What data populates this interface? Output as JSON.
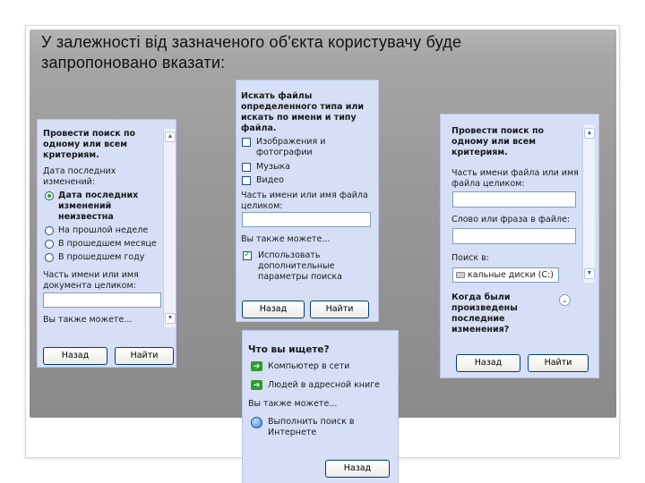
{
  "slide": {
    "title_line1": "У залежності від зазначеного об'єкта користувачу буде",
    "title_line2": "запропоновано вказати:"
  },
  "pane_left": {
    "header": "Провести поиск по одному или всем критериям.",
    "header_l1": "Провести поиск по",
    "header_l2": "одному или всем",
    "header_l3": "критериям.",
    "date_label_l1": "Дата последних",
    "date_label_l2": "изменений:",
    "options": [
      "Дата последних изменений неизвестна",
      "На прошлой неделе",
      "В прошедшем месяце",
      "В прошедшем году"
    ],
    "opt1_l1": "Дата последних",
    "opt1_l2": "изменений",
    "opt1_l3": "неизвестна",
    "name_label_l1": "Часть имени или имя",
    "name_label_l2": "документа целиком:",
    "name_value": "",
    "also": "Вы также можете...",
    "back": "Назад",
    "find": "Найти"
  },
  "pane_mid": {
    "header_l1": "Искать файлы",
    "header_l2": "определенного типа или",
    "header_l3": "искать по имени и типу",
    "header_l4": "файла.",
    "type1_l1": "Изображения и",
    "type1_l2": "фотографии",
    "type2": "Музыка",
    "type3": "Видео",
    "name_label_l1": "Часть имени или имя файла",
    "name_label_l2": "целиком:",
    "name_value": "",
    "also": "Вы также можете...",
    "adv_l1": "Использовать",
    "adv_l2": "дополнительные",
    "adv_l3": "параметры поиска",
    "back": "Назад",
    "find": "Найти"
  },
  "pane_right": {
    "header_l1": "Провести поиск по",
    "header_l2": "одному или всем",
    "header_l3": "критериям.",
    "name_label_l1": "Часть имени файла или имя",
    "name_label_l2": "файла целиком:",
    "name_value": "",
    "phrase_label": "Слово или фраза в файле:",
    "phrase_value": "",
    "lookin_label": "Поиск в:",
    "lookin_value": "кальные диски (C:)",
    "when_l1": "Когда были",
    "when_l2": "произведены",
    "when_l3": "последние",
    "when_l4": "изменения?",
    "back": "Назад",
    "find": "Найти"
  },
  "pane_bottom": {
    "question": "Что вы ищете?",
    "opt1": "Компьютер в сети",
    "opt2": "Людей в адресной книге",
    "also": "Вы также можете...",
    "internet_l1": "Выполнить поиск в",
    "internet_l2": "Интернете",
    "back": "Назад"
  },
  "colors": {
    "pane": "#d6dff5",
    "accent": "#2e9b2e",
    "title": "#111111"
  }
}
